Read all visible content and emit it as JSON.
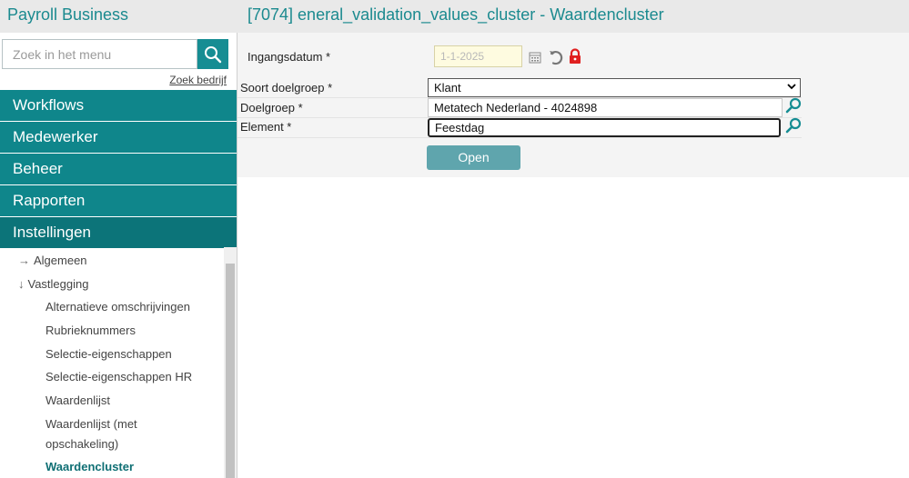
{
  "header": {
    "app_title": "Payroll Business",
    "page_title": "[7074] eneral_validation_values_cluster - Waardencluster"
  },
  "sidebar": {
    "search_placeholder": "Zoek in het menu",
    "search_link": "Zoek bedrijf",
    "nav": [
      {
        "label": "Workflows"
      },
      {
        "label": "Medewerker"
      },
      {
        "label": "Beheer"
      },
      {
        "label": "Rapporten"
      },
      {
        "label": "Instellingen"
      }
    ],
    "tree": {
      "algemeen": "Algemeen",
      "vastlegging": "Vastlegging",
      "items": [
        "Alternatieve omschrijvingen",
        "Rubrieknummers",
        "Selectie-eigenschappen",
        "Selectie-eigenschappen HR",
        "Waardenlijst",
        "Waardenlijst (met",
        "opschakeling)",
        "Waardencluster"
      ]
    }
  },
  "form": {
    "ingangsdatum_label": "Ingangsdatum *",
    "ingangsdatum_value": "1-1-2025",
    "soort_label": "Soort doelgroep *",
    "soort_value": "Klant",
    "doelgroep_label": "Doelgroep *",
    "doelgroep_value": "Metatech Nederland - 4024898",
    "element_label": "Element *",
    "element_value": "Feestdag",
    "open_label": "Open"
  },
  "icons": {
    "search": "search-icon",
    "calendar": "calendar-icon",
    "undo": "undo-icon",
    "lock": "lock-icon",
    "lookup": "magnifier-icon"
  },
  "colors": {
    "brand": "#0f868b",
    "title": "#1b8a8f",
    "lock": "#e02020",
    "button": "#5fa5ad"
  }
}
